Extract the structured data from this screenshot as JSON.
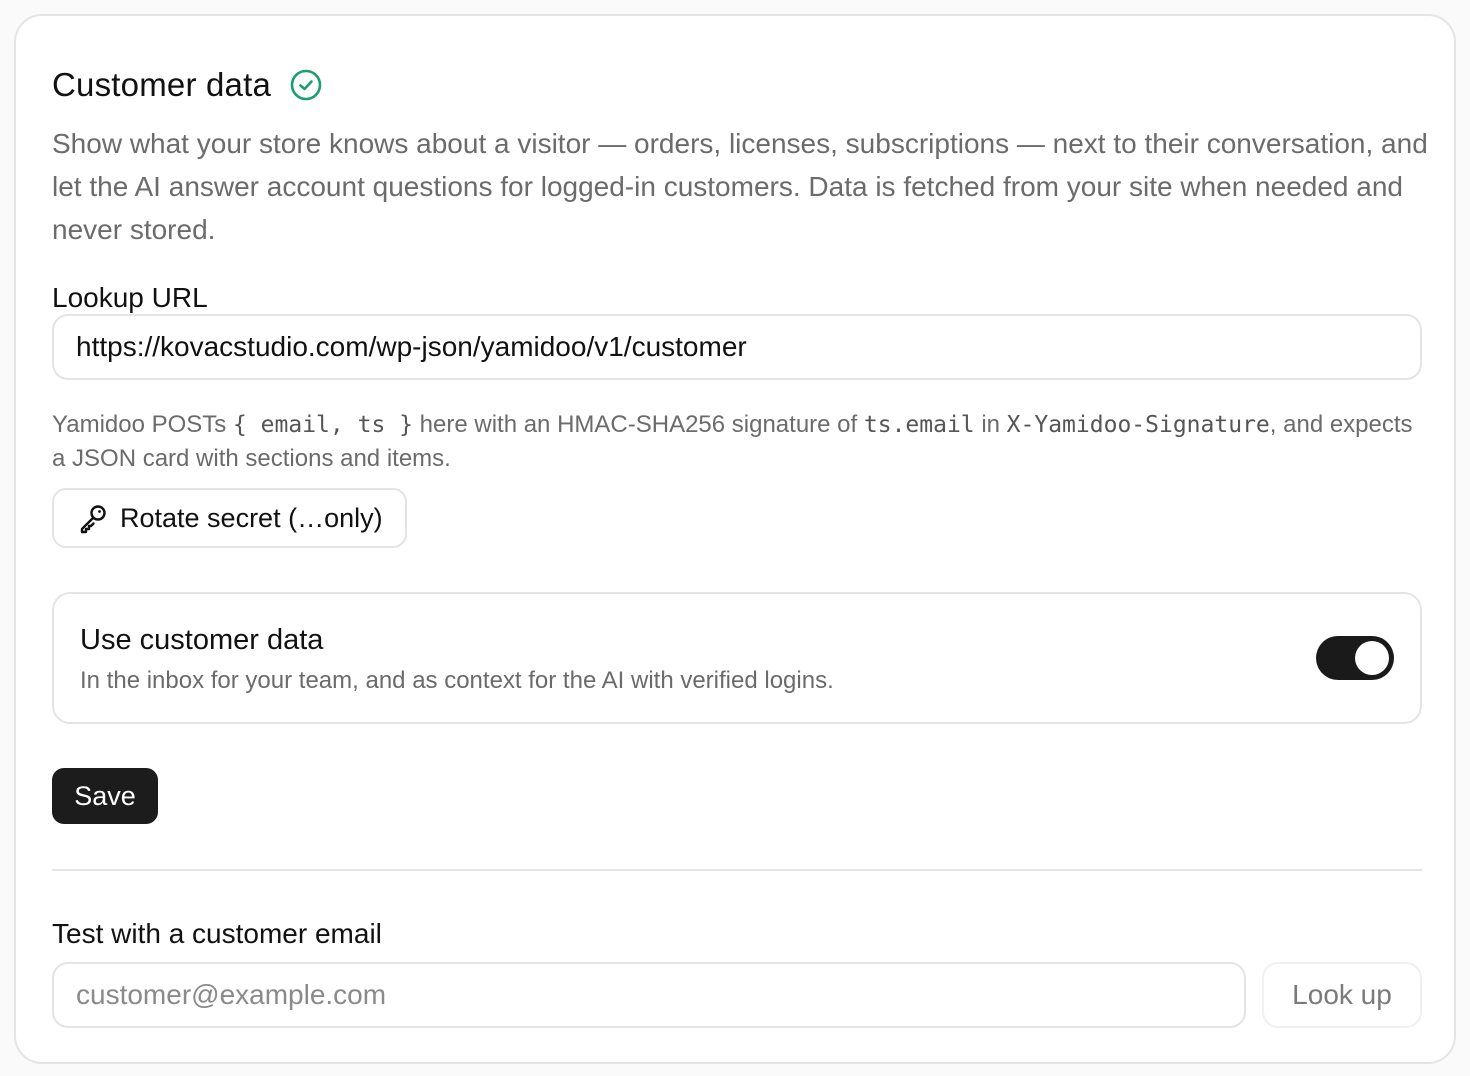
{
  "section": {
    "title": "Customer data",
    "description": "Show what your store knows about a visitor — orders, licenses, subscriptions — next to their conversation, and let the AI answer account questions for logged-in customers. Data is fetched from your site when needed and never stored."
  },
  "lookup": {
    "label": "Lookup URL",
    "value": "https://kovacstudio.com/wp-json/yamidoo/v1/customer",
    "help_prefix": "Yamidoo POSTs ",
    "help_code_body": "{ email, ts }",
    "help_mid": " here with an HMAC-SHA256 signature of ",
    "help_code_sig": "ts.email",
    "help_in": " in ",
    "help_code_header": "X-Yamidoo-Signature",
    "help_suffix": ", and expects a JSON card with sections and items."
  },
  "rotate_button": {
    "label": "Rotate secret (…only)"
  },
  "toggle": {
    "title": "Use customer data",
    "subtitle": "In the inbox for your team, and as context for the AI with verified logins.",
    "enabled": true
  },
  "save_button": {
    "label": "Save"
  },
  "test": {
    "label": "Test with a customer email",
    "placeholder": "customer@example.com",
    "button_label": "Look up"
  },
  "colors": {
    "accent_check": "#1a9e6e",
    "primary_button": "#1c1c1c",
    "border": "#e4e4e7",
    "muted_text": "#6b6b6b"
  }
}
